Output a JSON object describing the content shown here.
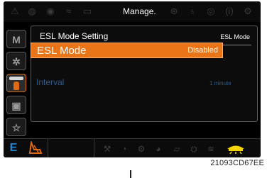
{
  "header": {
    "title": "Manage."
  },
  "side_tabs": [
    {
      "label": "M",
      "icon": "monitoring-tab"
    },
    {
      "label": "",
      "icon": "gear-icon"
    },
    {
      "label": "",
      "icon": "user-icon",
      "active": true
    },
    {
      "label": "",
      "icon": "display-icon"
    },
    {
      "label": "",
      "icon": "star-icon"
    }
  ],
  "panel": {
    "title": "ESL Mode Setting",
    "subtitle": "ESL Mode",
    "rows": [
      {
        "label": "ESL Mode",
        "value": "Disabled",
        "selected": true
      },
      {
        "label": "Interval",
        "value": "1 minute",
        "selected": false
      }
    ]
  },
  "footer": {
    "mode_letter": "E"
  },
  "caption": "21093CD67EE",
  "colors": {
    "accent": "#ea7418",
    "inactive_text": "#2d5d8c",
    "mode_letter": "#1e86d2",
    "lamp": "#f7d400"
  }
}
